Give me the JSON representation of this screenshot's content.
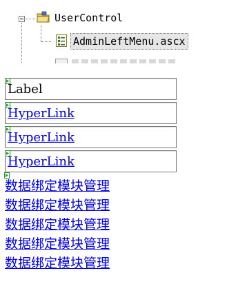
{
  "tree": {
    "folder": {
      "label": "UserControl",
      "icon": "folder-open-icon",
      "expander": "collapse-toggle-icon"
    },
    "selected_file": {
      "label": "AdminLeftMenu.ascx",
      "icon": "user-control-file-icon"
    },
    "partial_item": {
      "icon": "file-icon"
    }
  },
  "designer": {
    "glyph_icon": "control-glyph-icon",
    "controls": [
      {
        "type": "label",
        "text": "Label"
      },
      {
        "type": "hyperlink",
        "text": "HyperLink"
      },
      {
        "type": "hyperlink",
        "text": "HyperLink"
      },
      {
        "type": "hyperlink",
        "text": "HyperLink"
      }
    ],
    "menu_links": [
      "数据绑定模块管理",
      "数据绑定模块管理",
      "数据绑定模块管理",
      "数据绑定模块管理",
      "数据绑定模块管理"
    ]
  },
  "colors": {
    "link": "#0000ee",
    "glyph": "#2e9a2e",
    "selection": "#e6e6e6",
    "border": "#7a7a7a"
  }
}
